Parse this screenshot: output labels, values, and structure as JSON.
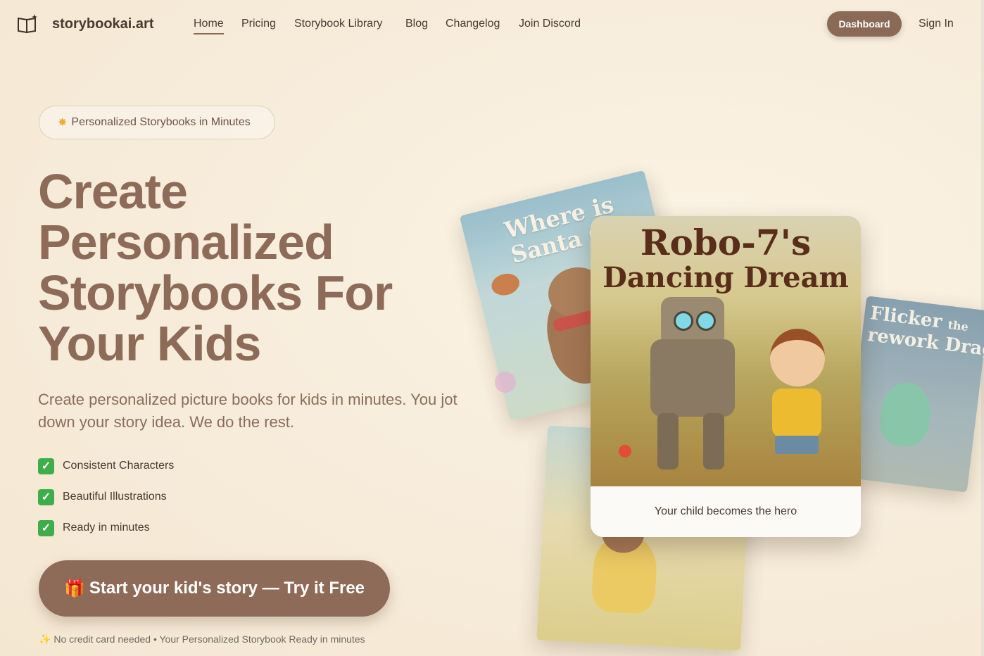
{
  "nav": {
    "brand": "storybookai.art",
    "links": [
      "Home",
      "Pricing",
      "Storybook Library",
      "Blog",
      "Changelog",
      "Join Discord"
    ],
    "dashboard": "Dashboard",
    "signin": "Sign In"
  },
  "hero": {
    "badge": "Personalized Storybooks in Minutes",
    "headline": [
      "Create",
      "Personalized",
      "Storybooks For",
      "Your Kids"
    ],
    "subtext": "Create personalized picture books for kids in minutes. You jot down your story idea. We do the rest.",
    "features": [
      "Consistent Characters",
      "Beautiful Illustrations",
      "Ready in minutes"
    ],
    "cta": "Start your kid's story — Try it Free",
    "footnote": "No credit card needed • Your Personalized Storybook Ready in minutes"
  },
  "books": {
    "main_title_1": "Robo-7's",
    "main_title_2": "Dancing Dream",
    "main_caption": "Your child becomes the hero",
    "santa_title_1": "Where is",
    "santa_title_2": "Santa C",
    "dragon_title_1": "Flicker",
    "dragon_title_the": "the",
    "dragon_title_2": "rework Dragon"
  },
  "colors": {
    "accent": "#8e6a58",
    "headline": "#8d6b58",
    "check": "#3fae4a"
  }
}
